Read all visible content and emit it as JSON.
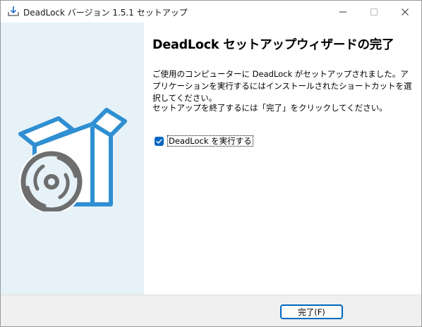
{
  "window": {
    "title": "DeadLock バージョン 1.5.1 セットアップ",
    "icons": {
      "app": "installer-icon",
      "minimize": "minimize-icon",
      "maximize": "maximize-icon",
      "close": "close-icon"
    }
  },
  "side_panel": {
    "illustration": "software-box-with-disc",
    "background": "#e6f1f8",
    "accent": "#2f8fd2"
  },
  "content": {
    "heading": "DeadLock セットアップウィザードの完了",
    "paragraph1": "ご使用のコンピューターに DeadLock がセットアップされました。アプリケーションを実行するにはインストールされたショートカットを選択してください。",
    "paragraph2": "セットアップを終了するには「完了」をクリックしてください。",
    "run_checkbox": {
      "label": "DeadLock を実行する",
      "checked": true
    }
  },
  "footer": {
    "finish_label": "完了(F)"
  }
}
